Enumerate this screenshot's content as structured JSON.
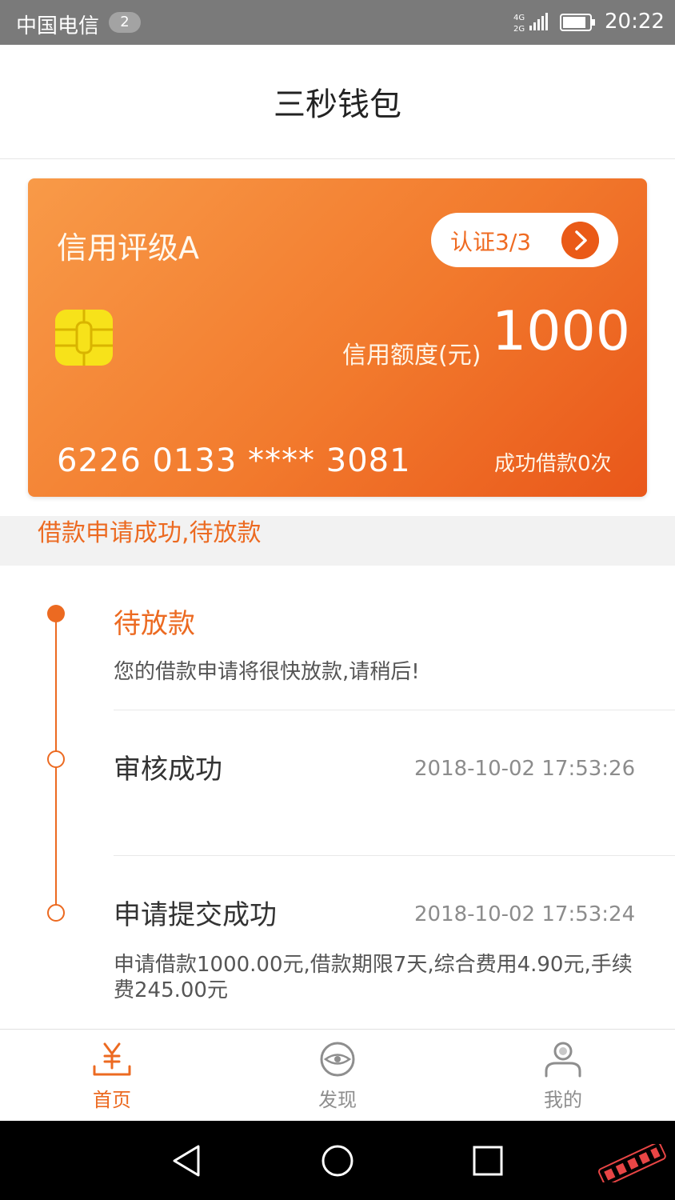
{
  "status_bar": {
    "carrier": "中国电信",
    "notification_count": "2",
    "network": "4G 2G",
    "time": "20:22"
  },
  "header": {
    "title": "三秒钱包"
  },
  "card": {
    "credit_rating": "信用评级A",
    "verify_label": "认证3/3",
    "limit_label": "信用额度(元)",
    "limit_value": "1000",
    "card_number": "6226 0133 **** 3081",
    "borrow_count": "成功借款0次"
  },
  "status_strip": {
    "text": "借款申请成功,待放款"
  },
  "timeline": [
    {
      "title": "待放款",
      "time": "",
      "desc": "您的借款申请将很快放款,请稍后!",
      "state": "current"
    },
    {
      "title": "审核成功",
      "time": "2018-10-02 17:53:26",
      "desc": "",
      "state": "done"
    },
    {
      "title": "申请提交成功",
      "time": "2018-10-02 17:53:24",
      "desc": "申请借款1000.00元,借款期限7天,综合费用4.90元,手续费245.00元",
      "state": "done"
    }
  ],
  "tabs": [
    {
      "label": "首页",
      "icon": "yen-wallet-icon",
      "active": true
    },
    {
      "label": "发现",
      "icon": "eye-icon",
      "active": false
    },
    {
      "label": "我的",
      "icon": "user-icon",
      "active": false
    }
  ],
  "colors": {
    "accent": "#ec6a21",
    "card_gradient_start": "#f89a48",
    "card_gradient_end": "#e9571a",
    "chip": "#f7e21a"
  }
}
